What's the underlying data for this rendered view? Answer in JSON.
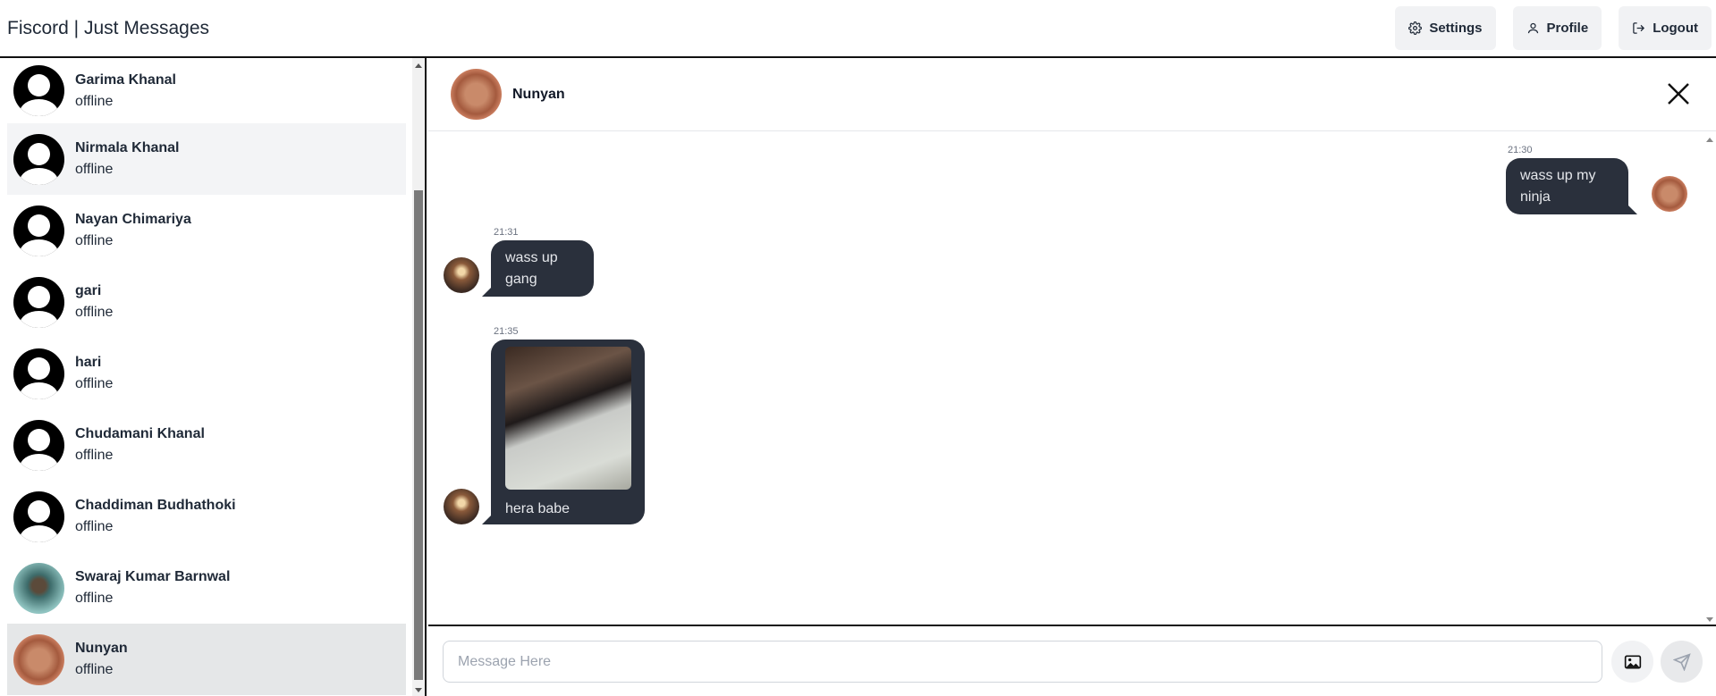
{
  "app": {
    "title": "Fiscord | Just Messages"
  },
  "nav": {
    "settings_label": "Settings",
    "profile_label": "Profile",
    "logout_label": "Logout"
  },
  "contacts": [
    {
      "name": "Garima Khanal",
      "status": "offline",
      "avatar": "default-user-icon"
    },
    {
      "name": "Nirmala Khanal",
      "status": "offline",
      "avatar": "default-user-icon"
    },
    {
      "name": "Nayan Chimariya",
      "status": "offline",
      "avatar": "default-user-icon"
    },
    {
      "name": "gari",
      "status": "offline",
      "avatar": "default-user-icon"
    },
    {
      "name": "hari",
      "status": "offline",
      "avatar": "default-user-icon"
    },
    {
      "name": "Chudamani Khanal",
      "status": "offline",
      "avatar": "default-user-icon"
    },
    {
      "name": "Chaddiman Budhathoki",
      "status": "offline",
      "avatar": "default-user-icon"
    },
    {
      "name": "Swaraj Kumar Barnwal",
      "status": "offline",
      "avatar": "photo"
    },
    {
      "name": "Nunyan",
      "status": "offline",
      "avatar": "photo"
    }
  ],
  "chat": {
    "contact_name": "Nunyan",
    "messages": [
      {
        "from": "me",
        "time": "21:30",
        "text": "wass up my ninja"
      },
      {
        "from": "them",
        "time": "21:31",
        "text": "wass up gang"
      },
      {
        "from": "them",
        "time": "21:35",
        "text": "hera babe",
        "has_image": true
      }
    ]
  },
  "composer": {
    "placeholder": "Message Here"
  },
  "colors": {
    "bubble": "#2a303c",
    "bubble_text": "#e5e7eb",
    "button_bg": "#f1f2f4",
    "active_row": "#e5e7e8"
  }
}
